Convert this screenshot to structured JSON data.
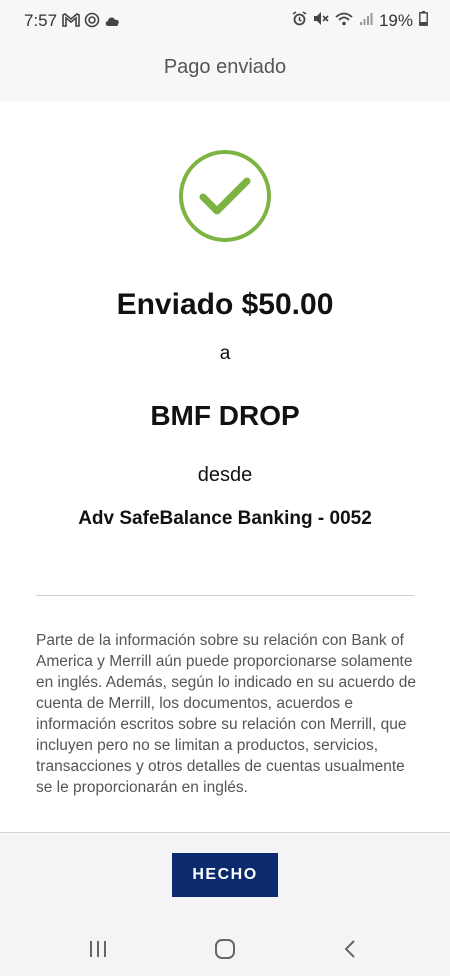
{
  "status_bar": {
    "time": "7:57",
    "battery": "19%",
    "left_icons": [
      "gmail-icon",
      "vpn-icon",
      "cloud-icon"
    ],
    "right_icons": [
      "alarm-icon",
      "mute-icon",
      "wifi-icon",
      "signal-icon",
      "battery-icon"
    ]
  },
  "header": {
    "title": "Pago enviado"
  },
  "confirmation": {
    "icon": "checkmark-circle-icon",
    "accent_color": "#7cb342",
    "sent_amount": "Enviado $50.00",
    "to_word": "a",
    "recipient": "BMF DROP",
    "from_word": "desde",
    "account": "Adv SafeBalance Banking - 0052"
  },
  "disclaimer": "Parte de la información sobre su relación con Bank of America y Merrill aún puede proporcionarse solamente en inglés. Además, según lo indicado en su acuerdo de cuenta de Merrill, los documentos, acuerdos e información escritos sobre su relación con Merrill, que incluyen pero no se limitan a productos, servicios, transacciones y otros detalles de cuentas usualmente se le proporcionarán en inglés.",
  "footer": {
    "done_label": "HECHO",
    "button_color": "#0c2a6e"
  },
  "nav_bar": {
    "icons": [
      "recent-apps-icon",
      "home-icon",
      "back-icon"
    ]
  }
}
